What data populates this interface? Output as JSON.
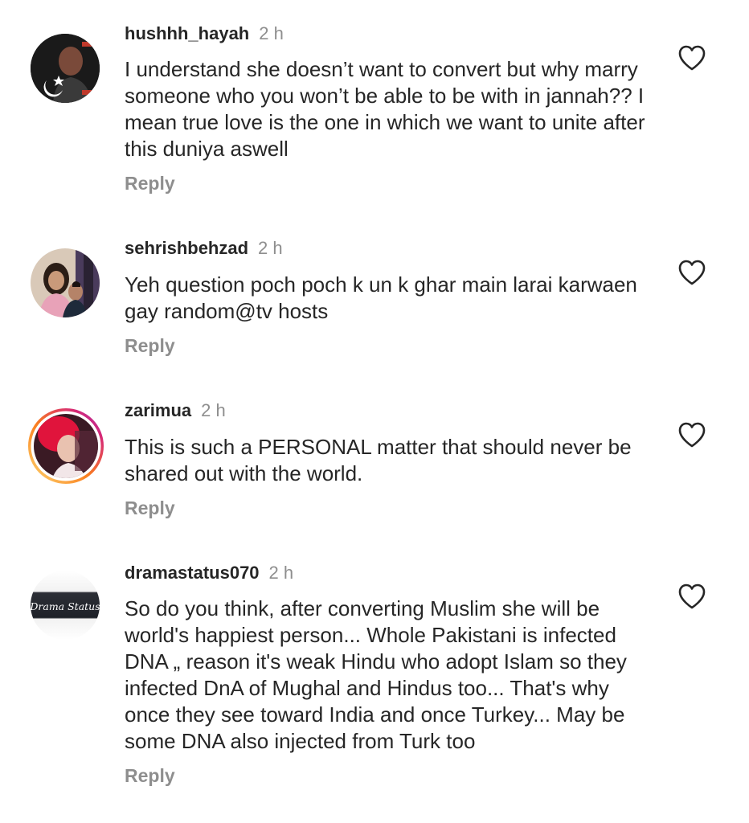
{
  "comments": [
    {
      "username": "hushhh_hayah",
      "time": "2 h",
      "text": "I understand she doesn’t want to convert but why marry someone who you won’t be able to be with in jannah?? I mean true love is the one in which we want to unite after this duniya aswell",
      "reply_label": "Reply",
      "avatar_icon": "profile-photo-avatar",
      "like_icon": "heart-outline-icon"
    },
    {
      "username": "sehrishbehzad",
      "time": "2 h",
      "text": "Yeh question poch poch k un k ghar main larai karwaen gay random@tv hosts",
      "reply_label": "Reply",
      "avatar_icon": "profile-photo-avatar",
      "like_icon": "heart-outline-icon"
    },
    {
      "username": "zarimua",
      "time": "2 h",
      "text": "This is such a PERSONAL matter that should never be shared out with the world.",
      "reply_label": "Reply",
      "avatar_icon": "profile-photo-avatar-with-story-ring",
      "like_icon": "heart-outline-icon"
    },
    {
      "username": "dramastatus070",
      "time": "2 h",
      "text": "So do you think, after converting Muslim she will be world's happiest person... Whole Pakistani is infected DNA „ reason it's weak Hindu who adopt Islam so they infected DnA of Mughal and Hindus too... That's why once they see toward India and once Turkey... May be some DNA also injected from Turk too",
      "reply_label": "Reply",
      "avatar_icon": "profile-logo-avatar",
      "avatar_text": "Drama Status",
      "like_icon": "heart-outline-icon"
    }
  ],
  "colors": {
    "text": "#262626",
    "muted": "#8e8e8e",
    "background": "#ffffff",
    "story_ring_start": "#feda75",
    "story_ring_end": "#d62976"
  }
}
